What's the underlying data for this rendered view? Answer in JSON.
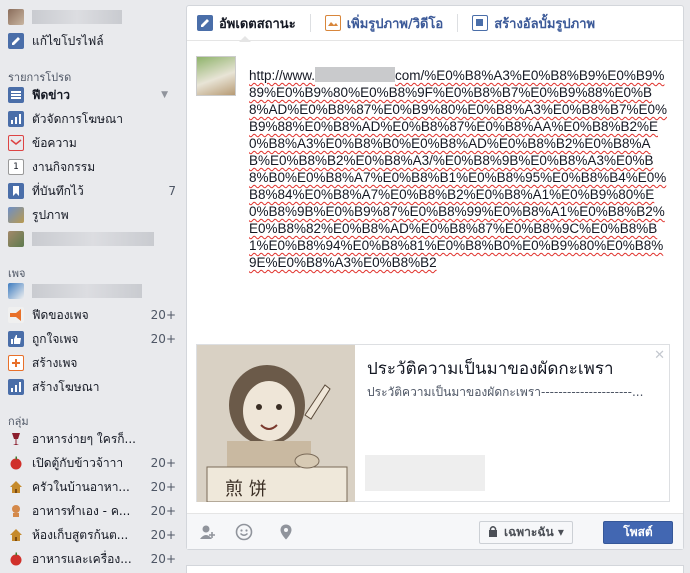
{
  "sidebar": {
    "profile_name": "",
    "edit_profile": "แก้ไขโปรไฟล์",
    "favorites_heading": "รายการโปรด",
    "favorites": [
      {
        "label": "ฟีดข่าว",
        "count": ""
      },
      {
        "label": "ตัวจัดการโฆษณา",
        "count": ""
      },
      {
        "label": "ข้อความ",
        "count": ""
      },
      {
        "label": "งานกิจกรรม",
        "count": "1"
      },
      {
        "label": "ที่บันทึกไว้",
        "count": "7"
      },
      {
        "label": "รูปภาพ",
        "count": ""
      }
    ],
    "pages_heading": "เพจ",
    "pages": [
      {
        "label": "ฟีดของเพจ",
        "count": "20+"
      },
      {
        "label": "ถูกใจเพจ",
        "count": "20+"
      },
      {
        "label": "สร้างเพจ",
        "count": ""
      },
      {
        "label": "สร้างโฆษณา",
        "count": ""
      }
    ],
    "groups_heading": "กลุ่ม",
    "groups": [
      {
        "label": "อาหารง่ายๆ ใครก็...",
        "count": ""
      },
      {
        "label": "เปิดตู้กับข้าวจ้าาา",
        "count": "20+"
      },
      {
        "label": "ครัวในบ้านอาหา...",
        "count": "20+"
      },
      {
        "label": "อาหารทำเอง - ค...",
        "count": "20+"
      },
      {
        "label": "ห้องเก็บสูตรก้นต...",
        "count": "20+"
      },
      {
        "label": "อาหารและเครื่อง...",
        "count": "20+"
      }
    ]
  },
  "composer": {
    "tabs": [
      {
        "label": "อัพเดตสถานะ"
      },
      {
        "label": "เพิ่มรูปภาพ/วิดีโอ"
      },
      {
        "label": "สร้างอัลบั้มรูปภาพ"
      }
    ],
    "post_prefix": "http://www.",
    "post_suffix": "com/%E0%B8%A3%E0%B8%B9%E0%B9%89%E0%B9%80%E0%B8%9F%E0%B8%B7%E0%B9%88%E0%B8%AD%E0%B8%87%E0%B9%80%E0%B8%A3%E0%B8%B7%E0%B9%88%E0%B8%AD%E0%B8%87%E0%B8%AA%E0%B8%B2%E0%B8%A3%E0%B8%B0%E0%B8%AD%E0%B8%B2%E0%B8%AB%E0%B8%B2%E0%B8%A3/%E0%B8%9B%E0%B8%A3%E0%B8%B0%E0%B8%A7%E0%B8%B1%E0%B8%95%E0%B8%B4%E0%B8%84%E0%B8%A7%E0%B8%B2%E0%B8%A1%E0%B9%80%E0%B8%9B%E0%B9%87%E0%B8%99%E0%B8%A1%E0%B8%B2%E0%B8%82%E0%B8%AD%E0%B8%87%E0%B8%9C%E0%B8%B1%E0%B8%94%E0%B8%81%E0%B8%B0%E0%B9%80%E0%B8%9E%E0%B8%A3%E0%B8%B2",
    "preview": {
      "title": "ประวัติความเป็นมาของผัดกะเพรา",
      "description": "ประวัติความเป็นมาของผัดกะเพรา---------------------...",
      "image_text": "煎   饼",
      "close_glyph": "✕"
    },
    "audience_label": "เฉพาะฉัน ▾",
    "post_button": "โพสต์"
  },
  "colors": {
    "accent": "#4267b2",
    "page_bg": "#e9eaed",
    "spell_underline": "#e0302a"
  }
}
